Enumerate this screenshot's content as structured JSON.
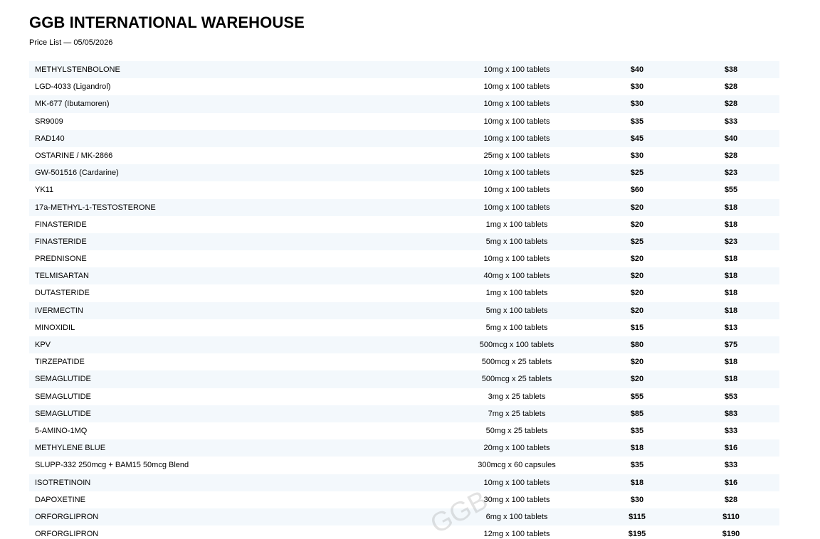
{
  "header": {
    "title": "GGB INTERNATIONAL WAREHOUSE",
    "subtitle": "Price List — 05/05/2026"
  },
  "watermark": "GGB",
  "rows": [
    {
      "name": "METHYLSTENBOLONE",
      "size": "10mg x 100 tablets",
      "price1": "$40",
      "price2": "$38"
    },
    {
      "name": "LGD-4033 (Ligandrol)",
      "size": "10mg x 100 tablets",
      "price1": "$30",
      "price2": "$28"
    },
    {
      "name": "MK-677 (Ibutamoren)",
      "size": "10mg x 100 tablets",
      "price1": "$30",
      "price2": "$28"
    },
    {
      "name": "SR9009",
      "size": "10mg x 100 tablets",
      "price1": "$35",
      "price2": "$33"
    },
    {
      "name": "RAD140",
      "size": "10mg x 100 tablets",
      "price1": "$45",
      "price2": "$40"
    },
    {
      "name": "OSTARINE / MK-2866",
      "size": "25mg x 100 tablets",
      "price1": "$30",
      "price2": "$28"
    },
    {
      "name": "GW-501516 (Cardarine)",
      "size": "10mg x 100 tablets",
      "price1": "$25",
      "price2": "$23"
    },
    {
      "name": "YK11",
      "size": "10mg x 100 tablets",
      "price1": "$60",
      "price2": "$55"
    },
    {
      "name": "17a-METHYL-1-TESTOSTERONE",
      "size": "10mg x 100 tablets",
      "price1": "$20",
      "price2": "$18"
    },
    {
      "name": "FINASTERIDE",
      "size": "1mg x 100 tablets",
      "price1": "$20",
      "price2": "$18"
    },
    {
      "name": "FINASTERIDE",
      "size": "5mg x 100 tablets",
      "price1": "$25",
      "price2": "$23"
    },
    {
      "name": "PREDNISONE",
      "size": "10mg x 100 tablets",
      "price1": "$20",
      "price2": "$18"
    },
    {
      "name": "TELMISARTAN",
      "size": "40mg x 100 tablets",
      "price1": "$20",
      "price2": "$18"
    },
    {
      "name": "DUTASTERIDE",
      "size": "1mg x 100 tablets",
      "price1": "$20",
      "price2": "$18"
    },
    {
      "name": "IVERMECTIN",
      "size": "5mg x 100 tablets",
      "price1": "$20",
      "price2": "$18"
    },
    {
      "name": "MINOXIDIL",
      "size": "5mg x 100 tablets",
      "price1": "$15",
      "price2": "$13"
    },
    {
      "name": "KPV",
      "size": "500mcg x 100 tablets",
      "price1": "$80",
      "price2": "$75"
    },
    {
      "name": "TIRZEPATIDE",
      "size": "500mcg x 25 tablets",
      "price1": "$20",
      "price2": "$18"
    },
    {
      "name": "SEMAGLUTIDE",
      "size": "500mcg x 25 tablets",
      "price1": "$20",
      "price2": "$18"
    },
    {
      "name": "SEMAGLUTIDE",
      "size": "3mg x 25 tablets",
      "price1": "$55",
      "price2": "$53"
    },
    {
      "name": "SEMAGLUTIDE",
      "size": "7mg x 25 tablets",
      "price1": "$85",
      "price2": "$83"
    },
    {
      "name": "5-AMINO-1MQ",
      "size": "50mg x 25 tablets",
      "price1": "$35",
      "price2": "$33"
    },
    {
      "name": "METHYLENE BLUE",
      "size": "20mg x 100 tablets",
      "price1": "$18",
      "price2": "$16"
    },
    {
      "name": "SLUPP-332 250mcg + BAM15 50mcg Blend",
      "size": "300mcg x 60 capsules",
      "price1": "$35",
      "price2": "$33"
    },
    {
      "name": "ISOTRETINOIN",
      "size": "10mg x 100 tablets",
      "price1": "$18",
      "price2": "$16"
    },
    {
      "name": "DAPOXETINE",
      "size": "30mg x 100 tablets",
      "price1": "$30",
      "price2": "$28"
    },
    {
      "name": "ORFORGLIPRON",
      "size": "6mg x 100 tablets",
      "price1": "$115",
      "price2": "$110"
    },
    {
      "name": "ORFORGLIPRON",
      "size": "12mg x 100 tablets",
      "price1": "$195",
      "price2": "$190"
    }
  ]
}
